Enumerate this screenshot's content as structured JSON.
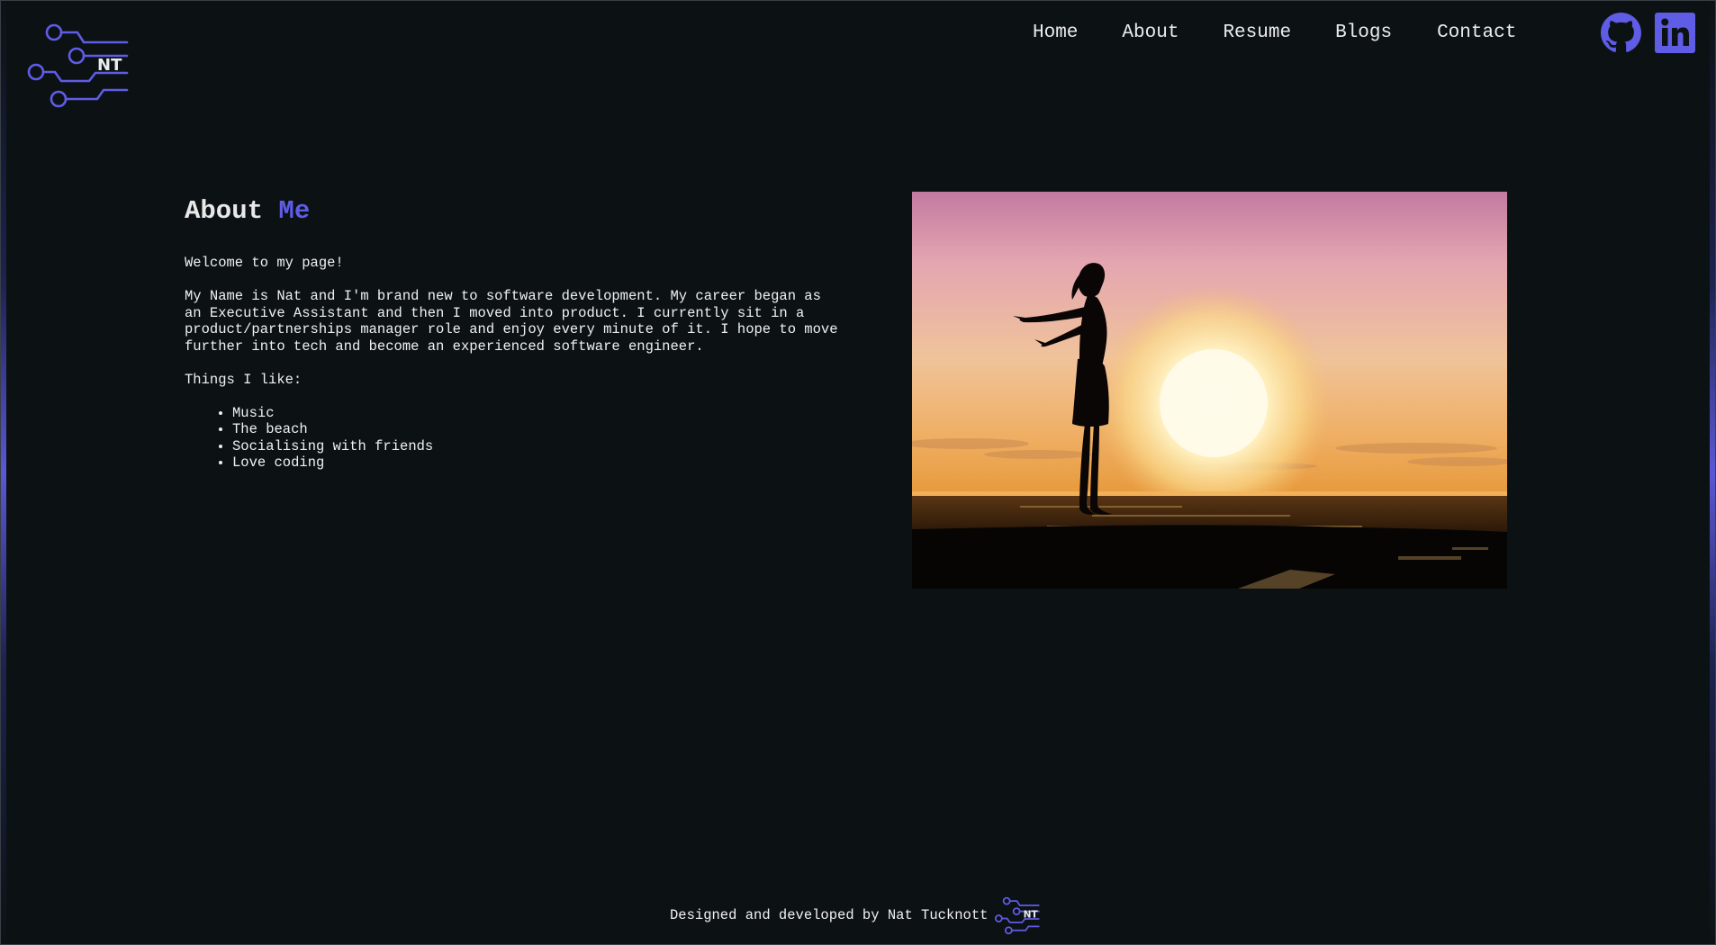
{
  "brand": {
    "logo_initials": "NT",
    "accent_color": "#5f5ce6",
    "background_color": "#0c1214"
  },
  "nav": {
    "items": [
      {
        "label": "Home"
      },
      {
        "label": "About"
      },
      {
        "label": "Resume"
      },
      {
        "label": "Blogs"
      },
      {
        "label": "Contact"
      }
    ]
  },
  "social": {
    "links": [
      {
        "icon": "github-icon"
      },
      {
        "icon": "linkedin-icon"
      }
    ]
  },
  "about": {
    "title_part1": "About",
    "title_part2": "Me",
    "welcome": "Welcome to my page!",
    "bio": "My Name is Nat and I'm brand new to software development. My career began as an Executive Assistant and then I moved into product. I currently sit in a product/partnerships manager role and enjoy every minute of it. I hope to move further into tech and become an experienced software engineer.",
    "likes_heading": "Things I like:",
    "likes": [
      "Music",
      "The beach",
      "Socialising with friends",
      "Love coding"
    ]
  },
  "photo": {
    "subject": "silhouette-at-sunset"
  },
  "footer": {
    "text": "Designed and developed by Nat Tucknott",
    "logo_initials": "NT"
  }
}
